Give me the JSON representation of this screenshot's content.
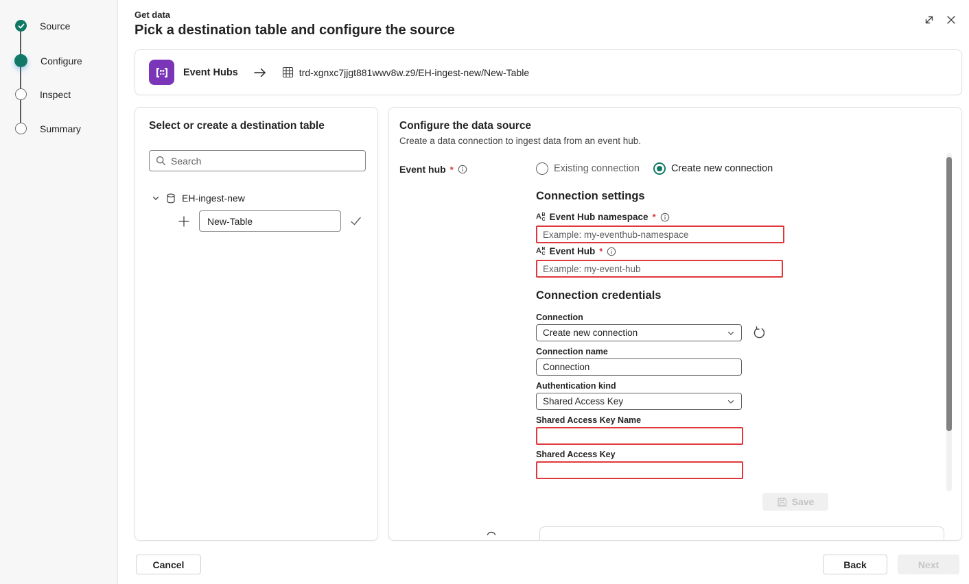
{
  "wizard_steps": {
    "items": [
      {
        "label": "Source",
        "state": "completed"
      },
      {
        "label": "Configure",
        "state": "current"
      },
      {
        "label": "Inspect",
        "state": "upcoming"
      },
      {
        "label": "Summary",
        "state": "upcoming"
      }
    ]
  },
  "header": {
    "eyebrow": "Get data",
    "title": "Pick a destination table and configure the source"
  },
  "source_banner": {
    "source_name": "Event Hubs",
    "destination_path": "trd-xgnxc7jjgt881wwv8w.z9/EH-ingest-new/New-Table"
  },
  "destination_panel": {
    "title": "Select or create a destination table",
    "search": {
      "placeholder": "Search"
    },
    "tree": {
      "database_label": "EH-ingest-new",
      "new_table": {
        "value": "New-Table"
      }
    }
  },
  "configure_panel": {
    "title": "Configure the data source",
    "subtitle": "Create a data connection to ingest data from an event hub.",
    "event_hub_field": {
      "label": "Event hub",
      "required_marker": "*"
    },
    "connection_mode": {
      "options": [
        {
          "label": "Existing connection",
          "selected": false
        },
        {
          "label": "Create new connection",
          "selected": true
        }
      ]
    },
    "connection_settings": {
      "heading": "Connection settings",
      "namespace_field": {
        "label": "Event Hub namespace",
        "required_marker": "*",
        "placeholder": "Example: my-eventhub-namespace",
        "value": ""
      },
      "hub_field": {
        "label": "Event Hub",
        "required_marker": "*",
        "placeholder": "Example: my-event-hub",
        "value": ""
      }
    },
    "connection_credentials": {
      "heading": "Connection credentials",
      "connection": {
        "label": "Connection",
        "value": "Create new connection"
      },
      "connection_name": {
        "label": "Connection name",
        "value": "Connection"
      },
      "authentication_kind": {
        "label": "Authentication kind",
        "value": "Shared Access Key"
      },
      "shared_access_key_name": {
        "label": "Shared Access Key Name",
        "value": ""
      },
      "shared_access_key": {
        "label": "Shared Access Key",
        "value": ""
      },
      "save_button": {
        "label": "Save",
        "enabled": false
      }
    }
  },
  "abc_icon": {
    "a": "A",
    "b": "B",
    "c": "C"
  },
  "footer": {
    "cancel_label": "Cancel",
    "back_label": "Back",
    "next_label": "Next"
  },
  "colors": {
    "accent_teal": "#117865",
    "event_hubs_purple": "#7a35b8",
    "validation_red": "#e0383a"
  }
}
